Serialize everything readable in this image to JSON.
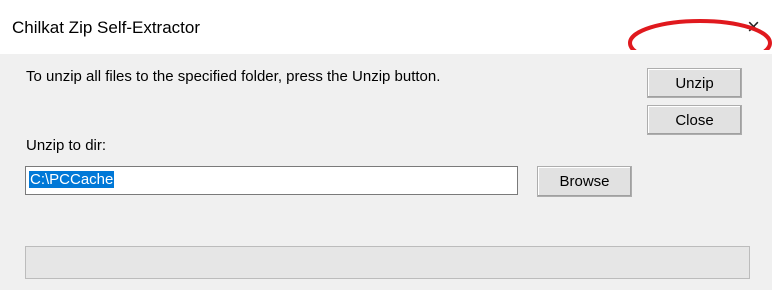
{
  "window": {
    "title": "Chilkat Zip Self-Extractor",
    "close_glyph": "×"
  },
  "main": {
    "instruction": "To unzip all files to the specified folder, press the Unzip button.",
    "unzip_label": "Unzip",
    "close_label": "Close",
    "dir_label": "Unzip to dir:",
    "dir_value": "C:\\PCCache",
    "browse_label": "Browse",
    "progress": 0
  },
  "annotation": {
    "highlight_color": "#e0191e"
  }
}
